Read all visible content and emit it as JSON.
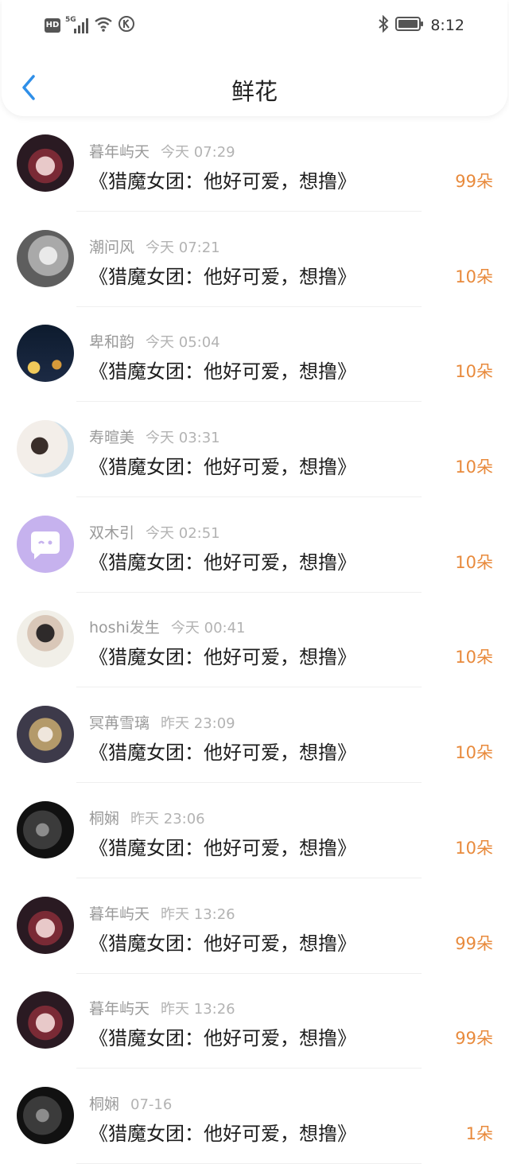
{
  "status_bar": {
    "hd_label": "HD",
    "network_label": "5G",
    "time": "8:12",
    "icons": [
      "signal-icon",
      "wifi-icon",
      "k-circle-icon",
      "bluetooth-icon",
      "battery-icon"
    ]
  },
  "nav": {
    "title": "鲜花",
    "back_icon": "chevron-left-icon",
    "back_color": "#2f8fe8"
  },
  "colors": {
    "accent_count": "#e88a3c",
    "meta": "#9a9a9a"
  },
  "items": [
    {
      "name": "暮年屿天",
      "time": "今天 07:29",
      "title": "《猎魔女团：他好可爱，想撸》",
      "count": "99朵",
      "avatar": "anime-dark-avatar"
    },
    {
      "name": "潮问风",
      "time": "今天 07:21",
      "title": "《猎魔女团：他好可爱，想撸》",
      "count": "10朵",
      "avatar": "grayscale-photo-avatar"
    },
    {
      "name": "卑和韵",
      "time": "今天 05:04",
      "title": "《猎魔女团：他好可爱，想撸》",
      "count": "10朵",
      "avatar": "night-lights-avatar"
    },
    {
      "name": "寿暄美",
      "time": "今天 03:31",
      "title": "《猎魔女团：他好可爱，想撸》",
      "count": "10朵",
      "avatar": "girl-pillow-avatar"
    },
    {
      "name": "双木引",
      "time": "今天 02:51",
      "title": "《猎魔女团：他好可爱，想撸》",
      "count": "10朵",
      "avatar": "chat-bubble-avatar"
    },
    {
      "name": "hoshi发生",
      "time": "今天 00:41",
      "title": "《猎魔女团：他好可爱，想撸》",
      "count": "10朵",
      "avatar": "selfie-photo-avatar"
    },
    {
      "name": "冥苒雪璃",
      "time": "昨天 23:09",
      "title": "《猎魔女团：他好可爱，想撸》",
      "count": "10朵",
      "avatar": "ornate-anime-avatar"
    },
    {
      "name": "桐娴",
      "time": "昨天 23:06",
      "title": "《猎魔女团：他好可爱，想撸》",
      "count": "10朵",
      "avatar": "dark-girl-avatar"
    },
    {
      "name": "暮年屿天",
      "time": "昨天 13:26",
      "title": "《猎魔女团：他好可爱，想撸》",
      "count": "99朵",
      "avatar": "anime-dark-avatar"
    },
    {
      "name": "暮年屿天",
      "time": "昨天 13:26",
      "title": "《猎魔女团：他好可爱，想撸》",
      "count": "99朵",
      "avatar": "anime-dark-avatar"
    },
    {
      "name": "桐娴",
      "time": "07-16",
      "title": "《猎魔女团：他好可爱，想撸》",
      "count": "1朵",
      "avatar": "dark-girl-avatar"
    }
  ]
}
